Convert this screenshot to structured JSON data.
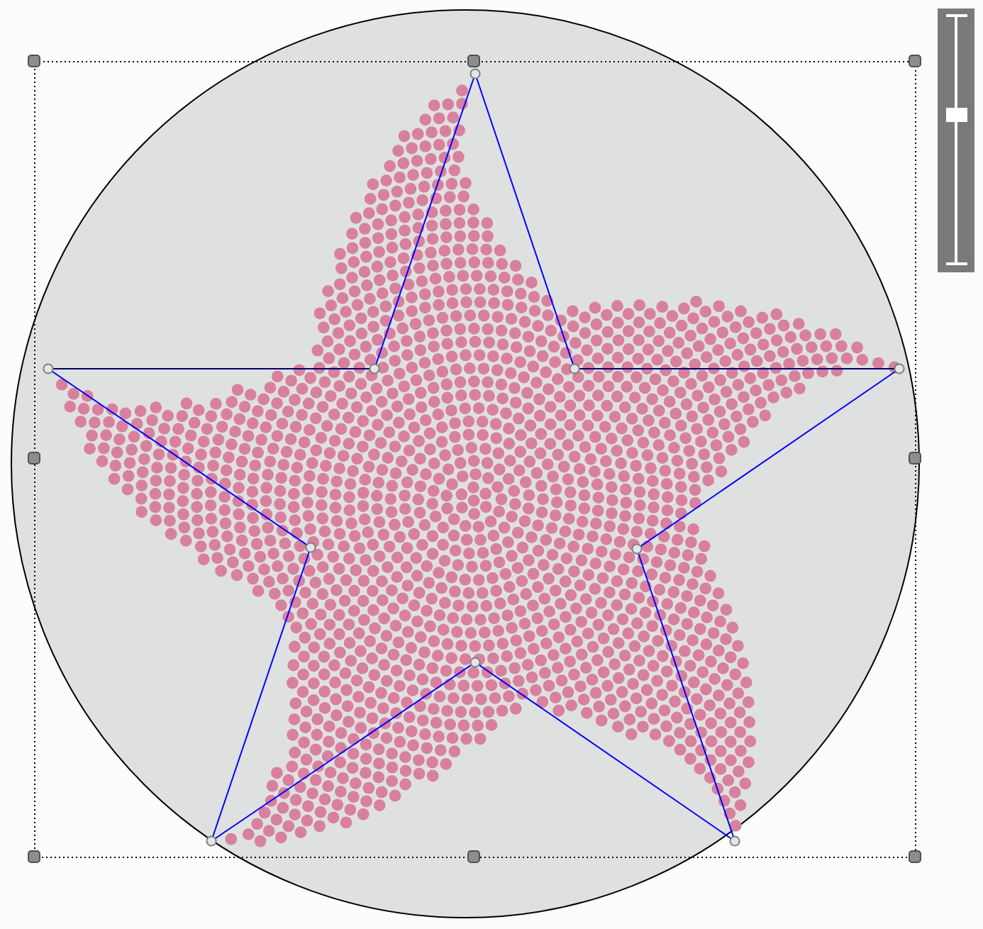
{
  "canvas": {
    "star": {
      "selected": true
    }
  },
  "zoom_slider": {
    "level": 0.6
  }
}
